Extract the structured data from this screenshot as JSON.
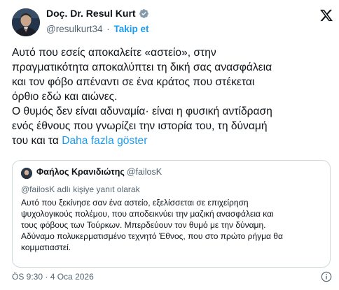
{
  "author": {
    "name": "Doç. Dr. Resul Kurt",
    "handle": "@resulkurt34",
    "separator": "·",
    "follow_label": "Takip et",
    "verified_color": "#1d9bf0"
  },
  "tweet": {
    "lines": [
      "Αυτό που εσείς αποκαλείτε «αστείο», στην",
      "πραγματικότητα αποκαλύπτει τη δική σας ανασφάλεια",
      "και τον φόβο απέναντι σε ένα κράτος που στέκεται",
      "όρθιο εδώ και αιώνες.",
      "Ο θυμός δεν είναι αδυναμία· είναι η φυσική αντίδραση",
      "ενός έθνους που γνωρίζει την ιστορία του, τη δύναμή",
      "του και τα"
    ],
    "show_more_label": "Daha fazla göster"
  },
  "quote": {
    "name": "Φαήλος Κρανιδιώτης",
    "handle": "@failosK",
    "reply_context": "@failosK adlı kişiye yanıt olarak",
    "lines": [
      "Αυτό που ξεκίνησε σαν ένα αστείο, εξελίσσεται σε επιχείρηση",
      "ψυχολογικούς πολέμου, που αποδεικνύει την μαζική ανασφάλεια και",
      "τους φόβους των Τούρκων. Μπερδεύουν τον θυμό με την δύναμη.",
      "Αδύναμο πολυκερματισμένο τεχνητό Έθνος, που στο πρώτο ρήγμα θα",
      "κομματιαστεί."
    ]
  },
  "footer": {
    "time": "ÖS 9:30",
    "separator": "·",
    "date": "4 Oca 2026"
  },
  "colors": {
    "accent": "#1d9bf0",
    "text": "#0f1419",
    "secondary": "#536471",
    "border": "#cfd9de"
  },
  "icons": {
    "verified": "verified-badge-icon",
    "x_logo": "x-logo-icon",
    "info": "info-icon"
  }
}
